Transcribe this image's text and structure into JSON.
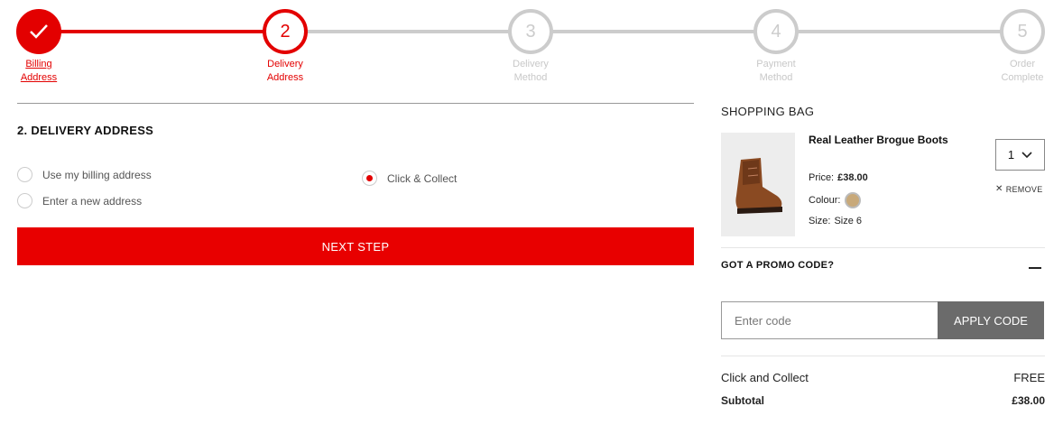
{
  "steps": [
    {
      "number": "✓",
      "label": "Billing\nAddress",
      "state": "done"
    },
    {
      "number": "2",
      "label": "Delivery\nAddress",
      "state": "active"
    },
    {
      "number": "3",
      "label": "Delivery\nMethod",
      "state": "todo"
    },
    {
      "number": "4",
      "label": "Payment\nMethod",
      "state": "todo"
    },
    {
      "number": "5",
      "label": "Order\nComplete",
      "state": "todo"
    }
  ],
  "delivery": {
    "title": "2. DELIVERY ADDRESS",
    "options": [
      {
        "label": "Use my billing address",
        "selected": false
      },
      {
        "label": "Enter a new address",
        "selected": false
      },
      {
        "label": "Click & Collect",
        "selected": true
      }
    ],
    "next_label": "NEXT STEP"
  },
  "bag": {
    "title": "SHOPPING BAG",
    "product": {
      "name": "Real Leather Brogue Boots",
      "price_label": "Price:",
      "price": "£38.00",
      "colour_label": "Colour:",
      "colour_hex": "#c8a97a",
      "size_label": "Size:",
      "size": "Size 6",
      "quantity": "1",
      "remove_label": "REMOVE"
    },
    "promo": {
      "title": "GOT A PROMO CODE?",
      "placeholder": "Enter code",
      "apply_label": "APPLY CODE"
    },
    "summary": {
      "method_label": "Click and Collect",
      "method_value": "FREE",
      "subtotal_label": "Subtotal",
      "subtotal_value": "£38.00"
    }
  },
  "colors": {
    "accent": "#e30000",
    "inactive": "#cccccc",
    "apply_button": "#6b6b6b"
  }
}
